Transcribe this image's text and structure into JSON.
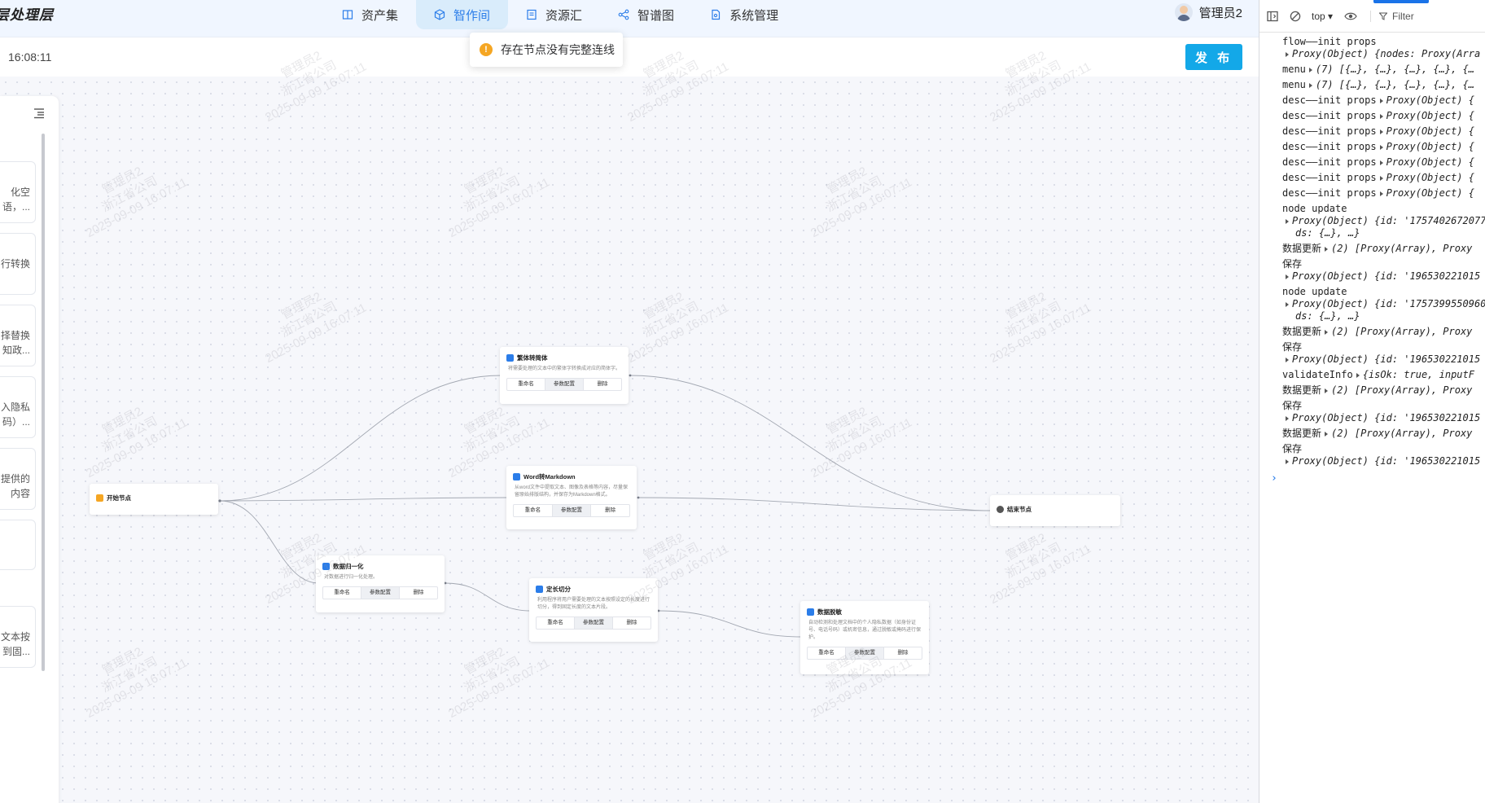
{
  "app": {
    "brand": "层处理层",
    "nav": [
      {
        "label": "资产集",
        "icon": "book-icon"
      },
      {
        "label": "智作间",
        "icon": "cube-icon",
        "active": true
      },
      {
        "label": "资源汇",
        "icon": "document-list-icon"
      },
      {
        "label": "智谱图",
        "icon": "share-graph-icon"
      },
      {
        "label": "系统管理",
        "icon": "file-settings-icon"
      }
    ],
    "user": "管理员2",
    "time": "16:08:11",
    "publish_label": "发 布",
    "toast": "存在节点没有完整连线",
    "watermark": {
      "line1": "管理员2",
      "line2": "浙江省公司",
      "line3": "2025-09-09 16:07:11"
    },
    "panel_cards": [
      "化空\n语，...",
      "行转换",
      "择替换\n知政...",
      "入隐私\n码）...",
      "提供的\n内容",
      "",
      "文本按\n到固..."
    ]
  },
  "flow": {
    "nodes": [
      {
        "id": "start",
        "title": "开始节点",
        "kind": "start",
        "desc": "",
        "buttons": []
      },
      {
        "id": "trad2simp",
        "title": "繁体转简体",
        "kind": "tool",
        "desc": "将需要处理的文本中的繁体字转换成对应的简体字。",
        "buttons": [
          "重命名",
          "参数配置",
          "删除"
        ]
      },
      {
        "id": "word2md",
        "title": "Word转Markdown",
        "kind": "tool",
        "desc": "从word文件中提取文本、图像及表格等内容，尽量保留原始排版结构，并保存为Markdown格式。",
        "buttons": [
          "重命名",
          "参数配置",
          "删除"
        ]
      },
      {
        "id": "normalize",
        "title": "数据归一化",
        "kind": "tool",
        "desc": "对数据进行归一化处理。",
        "buttons": [
          "重命名",
          "参数配置",
          "删除"
        ]
      },
      {
        "id": "fixedsplit",
        "title": "定长切分",
        "kind": "tool",
        "desc": "利用程序将用户需要处理的文本按照设定的长度进行切分，得到固定长度的文本片段。",
        "buttons": [
          "重命名",
          "参数配置",
          "删除"
        ]
      },
      {
        "id": "desensitize",
        "title": "数据脱敏",
        "kind": "tool",
        "desc": "自动检测和处理文档中的个人隐私数据（如身份证号、电话号码）或机密信息，通过脱敏或掩码进行保护。",
        "buttons": [
          "重命名",
          "参数配置",
          "删除"
        ]
      },
      {
        "id": "end",
        "title": "结束节点",
        "kind": "end",
        "desc": "",
        "buttons": []
      }
    ]
  },
  "devtools": {
    "context": "top",
    "filter_placeholder": "Filter",
    "lines": [
      {
        "msg": "flow——init props",
        "detail": "Proxy(Object) {nodes: Proxy(Arra"
      },
      {
        "msg": "menu",
        "detail": "(7) [{…}, {…}, {…}, {…}, {…"
      },
      {
        "msg": "menu",
        "detail": "(7) [{…}, {…}, {…}, {…}, {…"
      },
      {
        "msg": "desc——init props",
        "detail": "Proxy(Object) {"
      },
      {
        "msg": "desc——init props",
        "detail": "Proxy(Object) {"
      },
      {
        "msg": "desc——init props",
        "detail": "Proxy(Object) {"
      },
      {
        "msg": "desc——init props",
        "detail": "Proxy(Object) {"
      },
      {
        "msg": "desc——init props",
        "detail": "Proxy(Object) {"
      },
      {
        "msg": "desc——init props",
        "detail": "Proxy(Object) {"
      },
      {
        "msg": "desc——init props",
        "detail": "Proxy(Object) {"
      },
      {
        "msg": "node update",
        "detail": "Proxy(Object) {id: '1757402672077",
        "detail2": "ds: {…}, …}"
      },
      {
        "msg": "数据更新",
        "detail": "(2) [Proxy(Array), Proxy"
      },
      {
        "msg": "保存",
        "detail": "Proxy(Object) {id: '196530221015"
      },
      {
        "msg": "node update",
        "detail": "Proxy(Object) {id: '1757399550960",
        "detail2": "ds: {…}, …}"
      },
      {
        "msg": "数据更新",
        "detail": "(2) [Proxy(Array), Proxy"
      },
      {
        "msg": "保存",
        "detail": "Proxy(Object) {id: '196530221015"
      },
      {
        "msg": "validateInfo",
        "detail": "{isOk: true, inputF"
      },
      {
        "msg": "数据更新",
        "detail": "(2) [Proxy(Array), Proxy"
      },
      {
        "msg": "保存",
        "detail": "Proxy(Object) {id: '196530221015"
      },
      {
        "msg": "数据更新",
        "detail": "(2) [Proxy(Array), Proxy"
      },
      {
        "msg": "保存",
        "detail": "Proxy(Object) {id: '196530221015"
      }
    ],
    "prompt": "›"
  },
  "colors": {
    "accent": "#2b7de9",
    "publish": "#13a8e8",
    "warning": "#f5a623",
    "edge": "#9aa0aa"
  }
}
